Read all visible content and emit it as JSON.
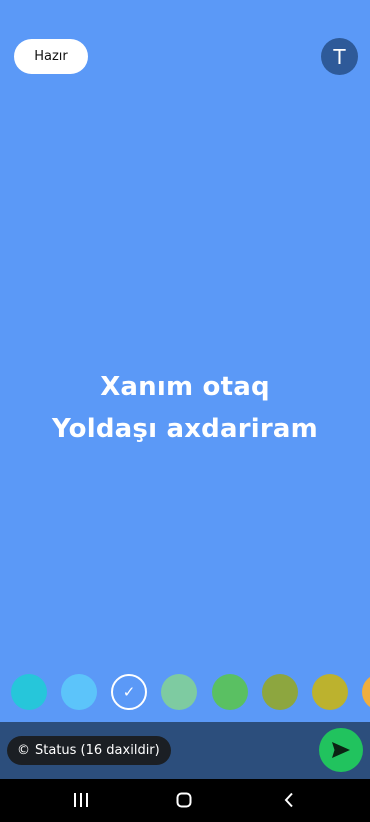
{
  "header": {
    "done_label": "Hazır",
    "text_tool_label": "T"
  },
  "status": {
    "lines": [
      "Xanım otaq",
      "Yoldaşı axdariram"
    ],
    "background_color": "#5B99F7"
  },
  "palette": {
    "colors": [
      "#26C6DA",
      "#5CC4FA",
      "#5B99F7",
      "#7ECBA1",
      "#5AC062",
      "#8DA63F",
      "#BCB22E",
      "#F0AE3E"
    ],
    "selected_index": 2
  },
  "footer": {
    "audience_label": "Status (16 daxildir)",
    "audience_icon": "privacy-icon",
    "send_icon": "send-icon"
  },
  "navigation": {
    "icons": [
      "recent-apps-icon",
      "home-icon",
      "back-icon"
    ]
  }
}
